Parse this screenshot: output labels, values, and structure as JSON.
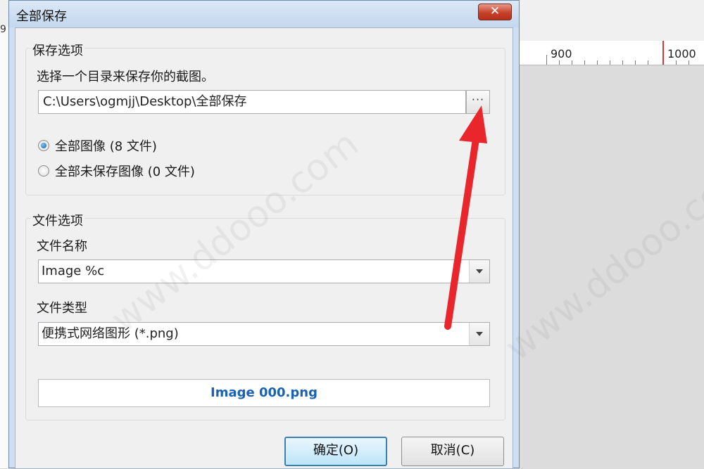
{
  "dialog": {
    "title": "全部保存",
    "close_glyph": "✕"
  },
  "background": {
    "ruler_labels": [
      "900",
      "1000"
    ],
    "left_char": "9"
  },
  "save_options": {
    "group_title": "保存选项",
    "instruction": "选择一个目录来保存你的截图。",
    "directory_value": "C:\\Users\\ogmjj\\Desktop\\全部保存",
    "browse_label": "···",
    "radio_all": "全部图像 (8 文件)",
    "radio_unsaved": "全部未保存图像 (0 文件)",
    "selected": "all"
  },
  "file_options": {
    "group_title": "文件选项",
    "name_label": "文件名称",
    "name_value": "Image %c",
    "type_label": "文件类型",
    "type_value": "便携式网络图形 (*.png)",
    "preview": "Image 000.png"
  },
  "buttons": {
    "ok": "确定(O)",
    "cancel": "取消(C)"
  },
  "watermark": "www.ddooo.com",
  "colors": {
    "accent": "#1a62b5",
    "arrow": "#e8262b",
    "close": "#c7412b"
  }
}
